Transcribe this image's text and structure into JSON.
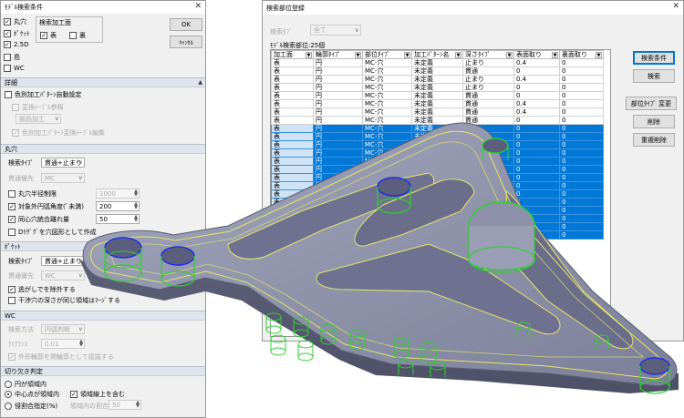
{
  "left_dialog": {
    "title": "ﾓﾃﾞﾙ検索条件",
    "faces": [
      {
        "label": "丸穴",
        "checked": true
      },
      {
        "label": "ﾎﾟｹｯﾄ",
        "checked": true
      },
      {
        "label": "2.5D",
        "checked": true
      },
      {
        "label": "島",
        "checked": false
      },
      {
        "label": "WC",
        "checked": false
      }
    ],
    "search_face_group_title": "検索加工面",
    "search_face_front": "表",
    "search_face_back": "裏",
    "ok_label": "OK",
    "cancel_label": "ｷｬﾝｾﾙ",
    "detail_section": "詳細",
    "auto_color_label": "色別加工ﾊﾟﾀｰﾝ自動設定",
    "conv_table_ref": "変換ﾃｰﾌﾞﾙ参照",
    "part_machining": "部品加工",
    "color_edit": "色別加工ﾊﾟﾀｰﾝ変換ﾃｰﾌﾞﾙ編集",
    "round_hole_section": "丸穴",
    "rh_search_type_label": "検索ﾀｲﾌﾟ",
    "rh_search_type_value": "貫通+止まり",
    "rh_through_label": "貫通優先",
    "rh_through_value": "MC",
    "rh_radius_limit_label": "丸穴半径制限",
    "rh_radius_limit_value": "1000",
    "rh_arc_angle_label": "対象外円弧角度(ﾟ未満)",
    "rh_arc_angle_value": "200",
    "rh_same_dist_label": "同心穴統合離れ量",
    "rh_same_dist_value": "50",
    "rh_as_pocket_label": "Dﾘｻﾞｸﾞを穴図形として作成",
    "pocket_section": "ﾎﾟｹｯﾄ",
    "pk_search_type_label": "検索ﾀｲﾌﾟ",
    "pk_search_type_value": "貫通+止まり",
    "pk_through_label": "貫通優先",
    "pk_through_value": "WC",
    "pk_seam_label": "逃がしでを除外する",
    "pk_merge_label": "干渉穴の深さが同じ領域はﾏｰｼﾞする",
    "wc_section": "WC",
    "wc_method_label": "検索方法",
    "wc_method_value": "円弧判断",
    "wc_tol_label": "ｸﾘｱﾗﾝｽ",
    "wc_tol_value": "0.01",
    "wc_outer_label": "外形輪郭を開輪郭として認識する",
    "cut_section": "切り欠き判定",
    "cut_opt1": "円が領域内",
    "cut_opt2": "中心点が領域内",
    "cut_opt2_check": "領域線上を含む",
    "cut_opt3": "侵割合指定(%)",
    "cut_opt3_sub": "領域内の割合",
    "cut_opt3_value": "50"
  },
  "right_dialog": {
    "title": "検索部位登録",
    "search_tab_label": "検索ﾀﾌﾞ",
    "search_tab_value": "全て",
    "count_label": "ﾓﾃﾞﾙ検索部位:25個",
    "columns": [
      "加工面",
      "輪郭ﾀｲﾌﾟ",
      "部位ﾀｲﾌﾟ",
      "加工ﾊﾟﾀｰﾝ名",
      "深さﾀｲﾌﾟ",
      "表面取り",
      "裏面取り"
    ],
    "rows": [
      [
        "表",
        "円",
        "MC-穴",
        "未定義",
        "止まり",
        "0.4",
        "0"
      ],
      [
        "表",
        "円",
        "MC-穴",
        "未定義",
        "貫通",
        "0",
        "0"
      ],
      [
        "表",
        "円",
        "MC-穴",
        "未定義",
        "止まり",
        "0.4",
        "0"
      ],
      [
        "表",
        "円",
        "MC-穴",
        "未定義",
        "止まり",
        "0",
        "0"
      ],
      [
        "表",
        "円",
        "MC-穴",
        "未定義",
        "貫通",
        "0",
        "0"
      ],
      [
        "表",
        "円",
        "MC-穴",
        "未定義",
        "貫通",
        "0.4",
        "0"
      ],
      [
        "表",
        "円",
        "MC-穴",
        "未定義",
        "貫通",
        "0.4",
        "0"
      ],
      [
        "表",
        "円",
        "MC-穴",
        "未定義",
        "貫通",
        "0",
        "0"
      ],
      [
        "表",
        "円",
        "MC-穴",
        "未定義",
        "貫通",
        "0",
        "0"
      ],
      [
        "表",
        "円",
        "MC-穴",
        "未定義",
        "貫通",
        "0",
        "0"
      ],
      [
        "表",
        "円",
        "MC-穴",
        "未定義",
        "貫通",
        "0",
        "0"
      ],
      [
        "表",
        "円",
        "MC-穴",
        "未定義",
        "貫通",
        "0",
        "0"
      ],
      [
        "表",
        "円",
        "MC-穴",
        "未定義",
        "貫通",
        "0",
        "0"
      ],
      [
        "表",
        "円",
        "MC-穴",
        "未定義",
        "貫通",
        "0",
        "0"
      ],
      [
        "表",
        "円",
        "MC-穴",
        "未定義",
        "貫通",
        "0",
        "0"
      ],
      [
        "表",
        "円",
        "MC-穴",
        "未定義",
        "貫通",
        "0",
        "0"
      ],
      [
        "表",
        "円",
        "MC-穴",
        "未定義",
        "貫通",
        "0",
        "0"
      ],
      [
        "表",
        "円",
        "MC-穴",
        "未定義",
        "貫通",
        "0",
        "0"
      ],
      [
        "表",
        "円",
        "MC-穴",
        "未定義",
        "貫通",
        "0",
        "0"
      ],
      [
        "表",
        "円",
        "MC-穴",
        "未定義",
        "貫通",
        "0.4",
        "0"
      ],
      [
        "表",
        "円",
        "MC-穴",
        "未定義",
        "貫通",
        "0.4",
        "0"
      ],
      [
        "表",
        "円",
        "MC-穴",
        "未定義",
        "貫通",
        "0",
        "0"
      ]
    ],
    "highlight_from_row": 8,
    "btn_search_cond": "検索条件",
    "btn_search": "検索",
    "btn_type_change": "部位ﾀｲﾌﾟ 変更",
    "btn_delete": "削除",
    "btn_dup_delete": "重複削除"
  },
  "colors": {
    "selection": "#0078d7",
    "part_fill": "#8a8ea6",
    "edge_yellow": "#e8e46a",
    "hole_green": "#2fd02f",
    "hole_blue": "#1f2fe0"
  }
}
